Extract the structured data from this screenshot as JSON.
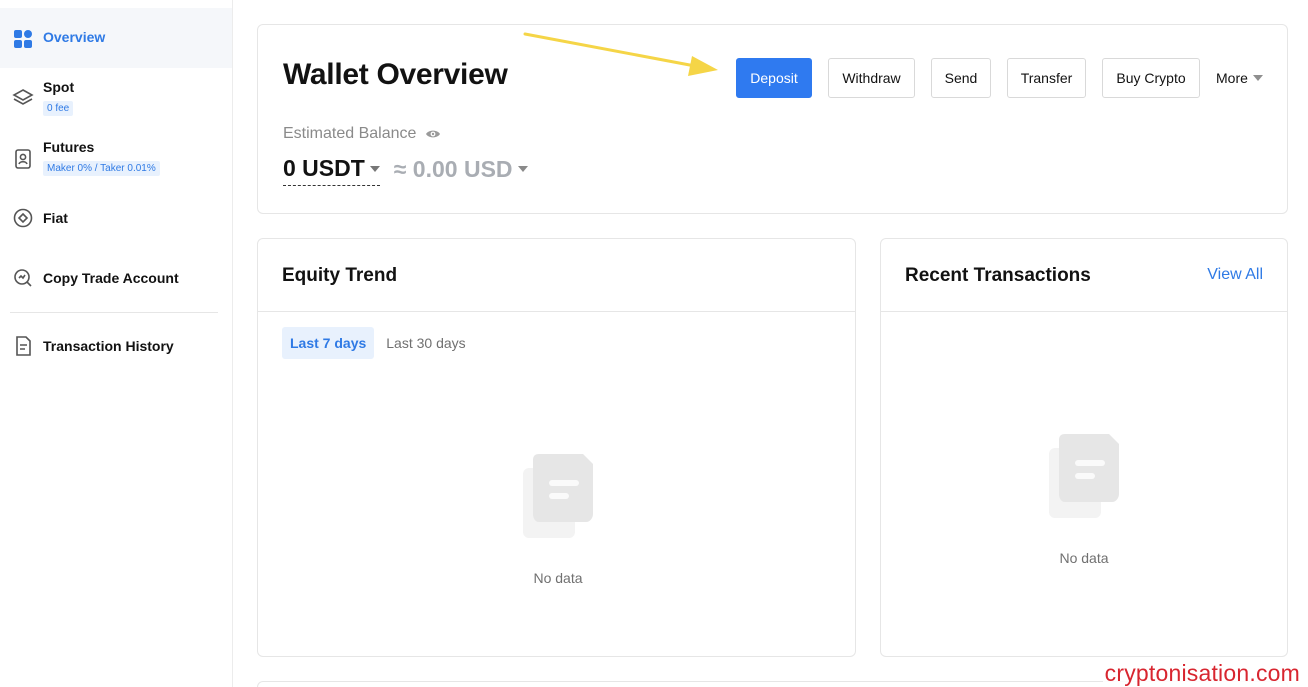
{
  "sidebar": {
    "items": [
      {
        "label": "Overview",
        "icon": "grid-icon",
        "active": true
      },
      {
        "label": "Spot",
        "icon": "layers-icon",
        "badge": "0 fee"
      },
      {
        "label": "Futures",
        "icon": "contract-icon",
        "badge": "Maker 0% / Taker 0.01%"
      },
      {
        "label": "Fiat",
        "icon": "fiat-icon"
      },
      {
        "label": "Copy Trade Account",
        "icon": "copy-trade-icon"
      },
      {
        "label": "Transaction History",
        "icon": "document-icon"
      }
    ]
  },
  "header": {
    "title": "Wallet Overview",
    "buttons": {
      "deposit": "Deposit",
      "withdraw": "Withdraw",
      "send": "Send",
      "transfer": "Transfer",
      "buy_crypto": "Buy Crypto",
      "more": "More"
    }
  },
  "balance": {
    "label": "Estimated Balance",
    "amount": "0 USDT",
    "approx": "≈ 0.00 USD"
  },
  "equity": {
    "title": "Equity Trend",
    "tabs": [
      "Last 7 days",
      "Last 30 days"
    ],
    "active_tab": 0,
    "empty_text": "No data"
  },
  "recent": {
    "title": "Recent Transactions",
    "view_all": "View All",
    "empty_text": "No data"
  },
  "watermark": "cryptonisation.com",
  "colors": {
    "accent": "#2f7ae5",
    "primary_button": "#2f7af0",
    "arrow": "#f5d547",
    "watermark": "#d8252f"
  }
}
